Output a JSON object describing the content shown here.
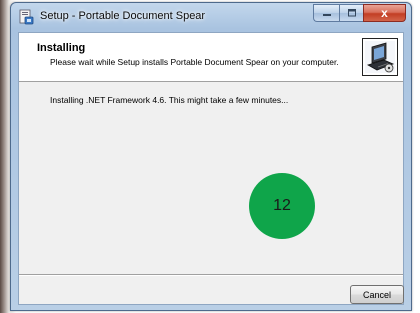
{
  "window": {
    "title": "Setup - Portable Document Spear",
    "controls": {
      "minimize_icon": "minimize-icon",
      "maximize_icon": "maximize-icon",
      "close_icon": "close-icon",
      "close_glyph": "x"
    }
  },
  "header": {
    "title": "Installing",
    "subtitle": "Please wait while Setup installs Portable Document Spear on your computer.",
    "logo_icon": "computer-setup-icon"
  },
  "body": {
    "status": "Installing .NET Framework 4.6. This might take a few minutes...",
    "step_number": "12",
    "step_color": "#0fa54a"
  },
  "footer": {
    "cancel_label": "Cancel"
  }
}
